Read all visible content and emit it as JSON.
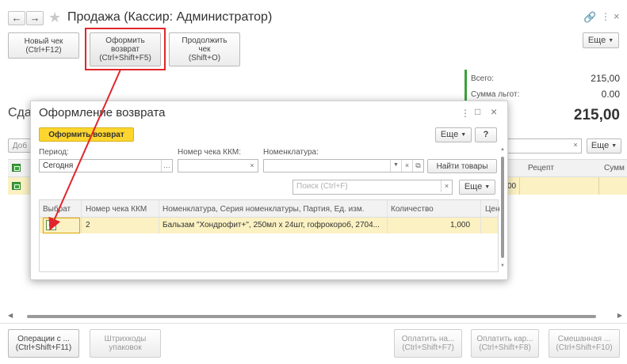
{
  "window": {
    "title": "Продажа (Кассир: Администратор)",
    "more_label": "Еще"
  },
  "toolbar": {
    "new_check": "Новый чек\n(Ctrl+F12)",
    "make_return": "Оформить\nвозврат\n(Ctrl+Shift+F5)",
    "continue_check": "Продолжить\nчек\n(Shift+O)"
  },
  "totals": {
    "total_label": "Всего:",
    "total_value": "215,00",
    "discount_label": "Сумма льгот:",
    "discount_value": "0.00",
    "big_total": "215,00"
  },
  "background": {
    "partial_heading": "Сда",
    "partial_add": "Доб",
    "recipe_col": "Рецепт",
    "sum_col": "Сумм",
    "row_value": "00",
    "more_label": "Еще"
  },
  "footer": {
    "operations": "Операции с ...\n(Ctrl+Shift+F11)",
    "barcodes": "Штрихкоды\nупаковок",
    "pay_cash": "Оплатить на...\n(Ctrl+Shift+F7)",
    "pay_card": "Оплатить кар...\n(Ctrl+Shift+F8)",
    "pay_mixed": "Смешанная ...\n(Ctrl+Shift+F10)"
  },
  "dialog": {
    "title": "Оформление возврата",
    "make_return_btn": "Оформить возврат",
    "more_label": "Еще",
    "help_label": "?",
    "period_label": "Период:",
    "period_value": "Сегодня",
    "kkm_label": "Номер чека ККМ:",
    "nomenclature_label": "Номенклатура:",
    "find_goods": "Найти товары",
    "search_placeholder": "Поиск (Ctrl+F)",
    "table_more": "Еще",
    "columns": {
      "select": "Выбрат",
      "kkm": "Номер чека ККМ",
      "nomenclature": "Номенклатура, Серия номенклатуры, Партия, Ед. изм.",
      "quantity": "Количество",
      "price": "Цен"
    },
    "rows": [
      {
        "checked": true,
        "kkm": "2",
        "nomenclature": "Бальзам \"Хондрофит+\", 250мл x 24шт, гофрокороб, 2704...",
        "quantity": "1,000"
      }
    ]
  },
  "colors": {
    "accent_yellow": "#fcd52e",
    "row_highlight": "#fbf1c2",
    "annotation_red": "#e0262c",
    "total_bar_green": "#3aa13a"
  }
}
